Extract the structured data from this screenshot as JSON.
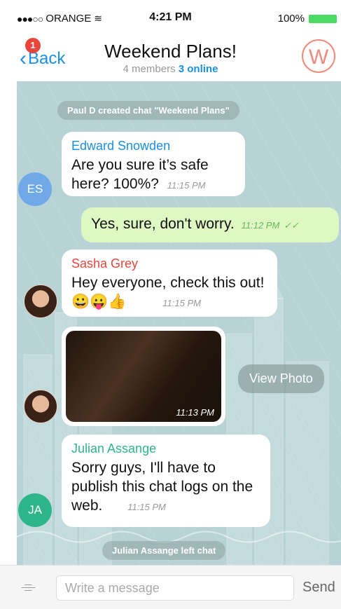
{
  "status_bar": {
    "carrier": "ORANGE",
    "time": "4:21 PM",
    "battery": "100%",
    "signal_dots": "●●●○○"
  },
  "nav": {
    "back_label": "Back",
    "back_badge": "1",
    "title": "Weekend Plans!",
    "members": "4 members",
    "online": "3 online",
    "avatar_letter": "W"
  },
  "chat": {
    "system_created": "Paul D created chat \"Weekend Plans\"",
    "messages": [
      {
        "sender": "Edward Snowden",
        "text": "Are you sure it’s safe here? 100%?",
        "time": "11:15 PM",
        "avatar": "ES"
      },
      {
        "text": "Yes, sure, don't worry.",
        "time": "11:12 PM",
        "check": "✓✓"
      },
      {
        "sender": "Sasha Grey",
        "text": "Hey everyone, check this out! 😀😛👍",
        "time": "11:15 PM"
      },
      {
        "photo_time": "11:13 PM"
      },
      {
        "sender": "Julian Assange",
        "text": "Sorry guys, I'll have to publish this chat logs on the web.",
        "time": "11:15 PM",
        "avatar": "JA"
      }
    ],
    "view_photo": "View Photo",
    "system_left": "Julian Assange left chat"
  },
  "input": {
    "placeholder": "Write a message",
    "send_label": "Send"
  },
  "colors": {
    "accent": "#1a8fe3",
    "chat_bg": "#b8d3d6",
    "outgoing_bubble": "#dff7c2",
    "badge": "#e8463d",
    "edward": "#1a8fe3",
    "sasha": "#e8463d",
    "julian": "#2fb58a"
  }
}
